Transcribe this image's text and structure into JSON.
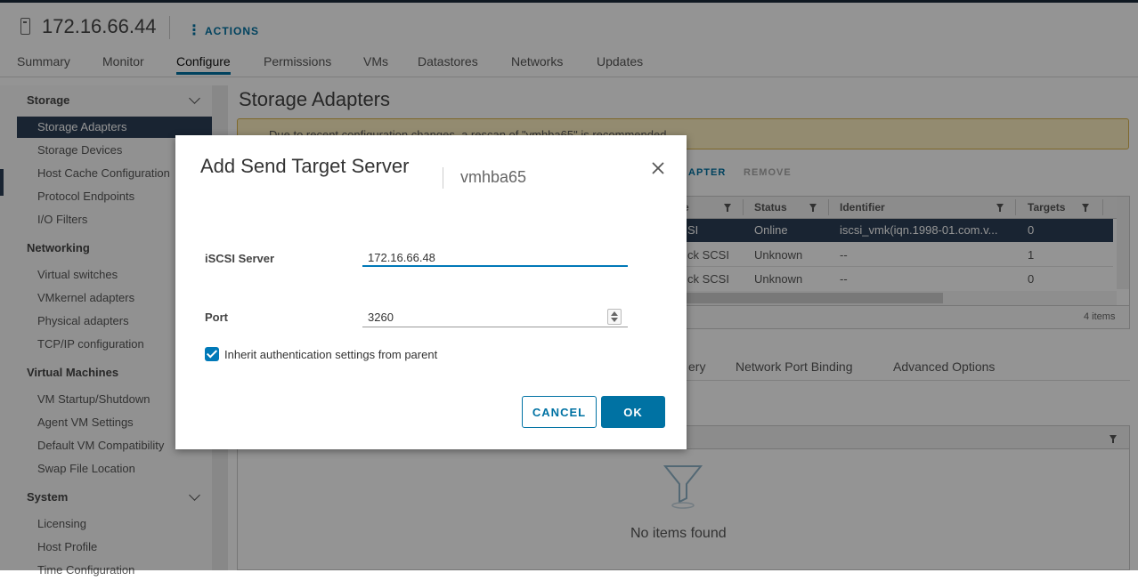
{
  "header": {
    "host_title": "172.16.66.44",
    "actions_label": "ACTIONS"
  },
  "tabs": [
    "Summary",
    "Monitor",
    "Configure",
    "Permissions",
    "VMs",
    "Datastores",
    "Networks",
    "Updates"
  ],
  "active_tab": "Configure",
  "sidebar": {
    "groups": {
      "storage": "Storage",
      "networking": "Networking",
      "virtual_machines": "Virtual Machines",
      "system": "System"
    },
    "items": {
      "storage_adapters": "Storage Adapters",
      "storage_devices": "Storage Devices",
      "host_cache": "Host Cache Configuration",
      "protocol_endpoints": "Protocol Endpoints",
      "io_filters": "I/O Filters",
      "virtual_switches": "Virtual switches",
      "vmkernel_adapters": "VMkernel adapters",
      "physical_adapters": "Physical adapters",
      "tcpip": "TCP/IP configuration",
      "vm_startup": "VM Startup/Shutdown",
      "agent_vm": "Agent VM Settings",
      "default_vm_compat": "Default VM Compatibility",
      "swap_file": "Swap File Location",
      "licensing": "Licensing",
      "host_profile": "Host Profile",
      "time_config": "Time Configuration"
    }
  },
  "main": {
    "page_title": "Storage Adapters",
    "warning": "Due to recent configuration changes, a rescan of \"vmhba65\" is recommended.",
    "toolbar": {
      "add_adapter": "APTER",
      "remove": "REMOVE"
    },
    "columns": {
      "type": "e",
      "status": "Status",
      "identifier": "Identifier",
      "targets": "Targets"
    },
    "rows": [
      {
        "type": "SI",
        "status": "Online",
        "identifier": "iscsi_vmk(iqn.1998-01.com.v...",
        "targets": "0"
      },
      {
        "type": "ck SCSI",
        "status": "Unknown",
        "identifier": "--",
        "targets": "1"
      },
      {
        "type": "ck SCSI",
        "status": "Unknown",
        "identifier": "--",
        "targets": "0"
      }
    ],
    "items_count": "4 items",
    "subtabs": [
      "ery",
      "Network Port Binding",
      "Advanced Options"
    ],
    "empty_text": "No items found"
  },
  "dialog": {
    "title": "Add Send Target Server",
    "subtitle": "vmhba65",
    "server_label": "iSCSI Server",
    "server_value": "172.16.66.48",
    "port_label": "Port",
    "port_value": "3260",
    "inherit_label": "Inherit authentication settings from parent",
    "inherit_checked": true,
    "cancel_label": "CANCEL",
    "ok_label": "OK"
  },
  "colors": {
    "accent": "#0072a3",
    "selected_row": "#2b3f56",
    "warning_bg": "#fdf0c1"
  }
}
